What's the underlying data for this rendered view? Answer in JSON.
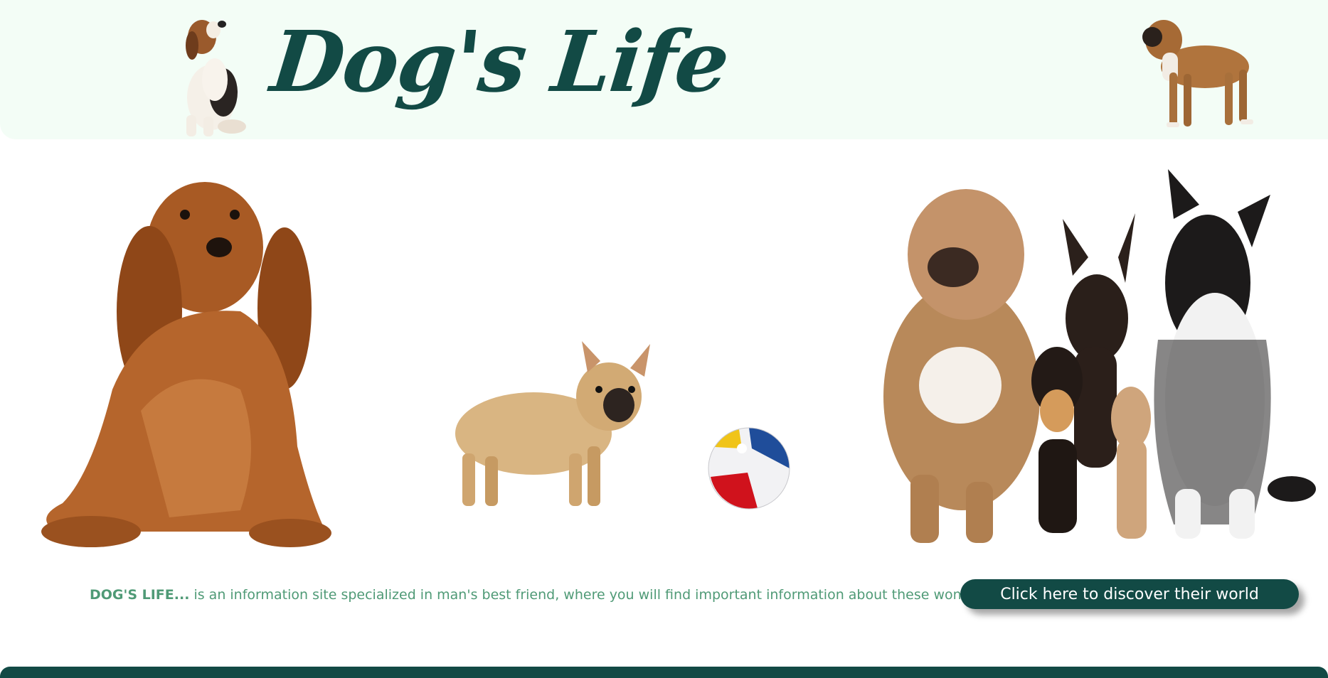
{
  "header": {
    "logo_text": "Dog's Life"
  },
  "images": {
    "beagle": "beagle-dog-image",
    "boxer": "boxer-dog-image",
    "cocker": "cocker-spaniel-image",
    "bulldog": "french-bulldog-image",
    "ball": "beach-ball-image",
    "group": "dog-group-image"
  },
  "intro": {
    "brand": "DOG'S LIFE...",
    "text": " is an information site specialized in man's best friend, where you will find important information about these wonderful animals... "
  },
  "cta": {
    "label": "Click here to discover their world"
  },
  "colors": {
    "primary": "#124a45",
    "header_bg": "#f3fdf6",
    "text_green": "#4f9a76"
  }
}
